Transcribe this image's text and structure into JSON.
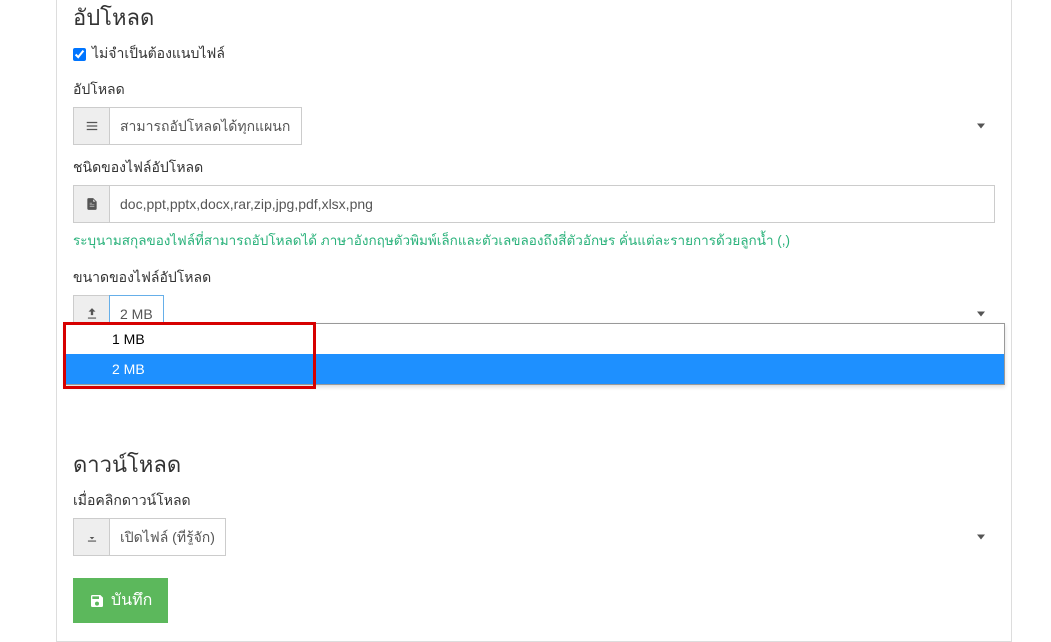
{
  "upload": {
    "section_title": "อัปโหลด",
    "checkbox_label": "ไม่จำเป็นต้องแนบไฟล์",
    "permission_label": "อัปโหลด",
    "permission_value": "สามารถอัปโหลดได้ทุกแผนก",
    "filetype_label": "ชนิดของไฟล์อัปโหลด",
    "filetype_value": "doc,ppt,pptx,docx,rar,zip,jpg,pdf,xlsx,png",
    "filetype_hint": "ระบุนามสกุลของไฟล์ที่สามารถอัปโหลดได้ ภาษาอังกฤษตัวพิมพ์เล็กและตัวเลขลองถึงสี่ตัวอักษร คั่นแต่ละรายการด้วยลูกน้ำ (,)",
    "filesize_label": "ขนาดของไฟล์อัปโหลด",
    "filesize_value": "2 MB",
    "filesize_options": [
      "1 MB",
      "2 MB"
    ]
  },
  "download": {
    "section_title": "ดาวน์โหลด",
    "onclick_label": "เมื่อคลิกดาวน์โหลด",
    "onclick_value": "เปิดไฟล์ (ที่รู้จัก)"
  },
  "buttons": {
    "save": "บันทึก"
  }
}
